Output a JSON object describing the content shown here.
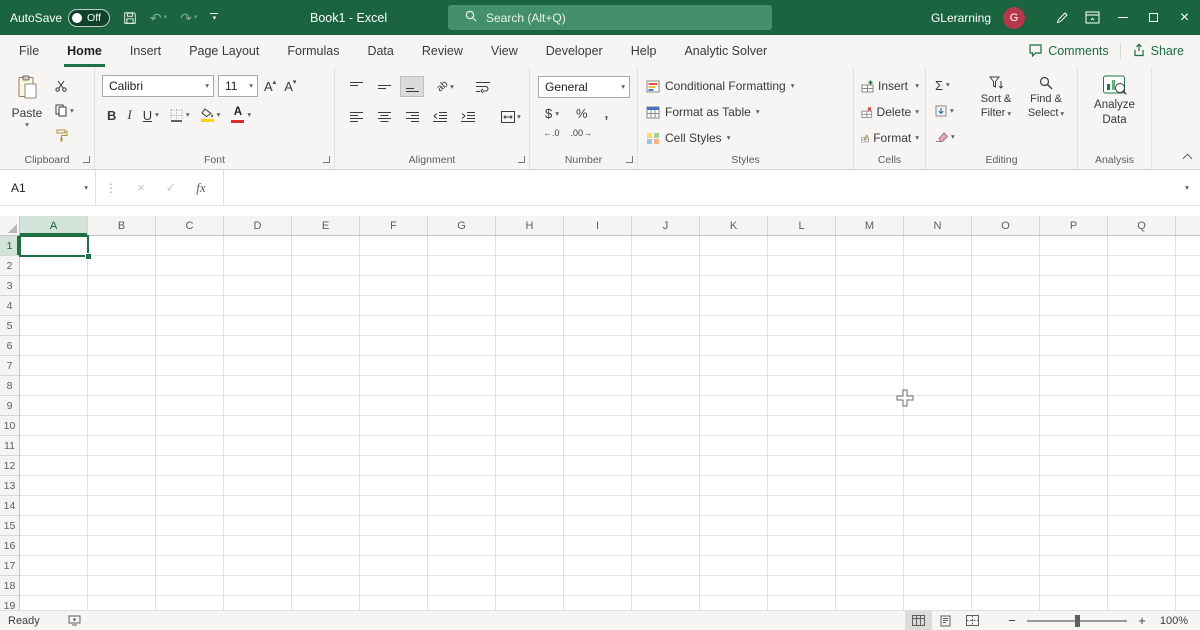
{
  "colors": {
    "titlebar_green": "#1a6440",
    "search_box_green": "#44906a",
    "accent_green": "#1f7145",
    "avatar_red": "#b5394a",
    "fill_color_swatch": "#ffd400",
    "font_color_swatch": "#d92b2b",
    "selected_header_bg": "#d3e3da"
  },
  "titlebar": {
    "autosave_label": "AutoSave",
    "autosave_state": "Off",
    "workbook_title": "Book1  -  Excel",
    "search_placeholder": "Search (Alt+Q)",
    "user_name": "GLerarning",
    "avatar_initial": "G"
  },
  "tabs": {
    "items": [
      {
        "label": "File",
        "active": false
      },
      {
        "label": "Home",
        "active": true
      },
      {
        "label": "Insert",
        "active": false
      },
      {
        "label": "Page Layout",
        "active": false
      },
      {
        "label": "Formulas",
        "active": false
      },
      {
        "label": "Data",
        "active": false
      },
      {
        "label": "Review",
        "active": false
      },
      {
        "label": "View",
        "active": false
      },
      {
        "label": "Developer",
        "active": false
      },
      {
        "label": "Help",
        "active": false
      },
      {
        "label": "Analytic Solver",
        "active": false
      }
    ],
    "comments_label": "Comments",
    "share_label": "Share"
  },
  "ribbon": {
    "clipboard": {
      "group_label": "Clipboard",
      "paste_label": "Paste"
    },
    "font": {
      "group_label": "Font",
      "font_name": "Calibri",
      "font_size": "11",
      "grow_font_letter": "A",
      "shrink_font_letter": "A",
      "bold_label": "B",
      "italic_label": "I",
      "underline_label": "U",
      "font_color_letter": "A"
    },
    "alignment": {
      "group_label": "Alignment",
      "orientation_text": "ab"
    },
    "number": {
      "group_label": "Number",
      "format_value": "General",
      "currency_label": "$",
      "percent_label": "%",
      "comma_label": ",",
      "increase_decimal_label": "←.0",
      "decrease_decimal_label": ".00→"
    },
    "styles": {
      "group_label": "Styles",
      "conditional_label": "Conditional Formatting",
      "table_label": "Format as Table",
      "cell_styles_label": "Cell Styles"
    },
    "cells": {
      "group_label": "Cells",
      "insert_label": "Insert",
      "delete_label": "Delete",
      "format_label": "Format"
    },
    "editing": {
      "group_label": "Editing",
      "autosum_symbol": "Σ",
      "sort_line1": "Sort &",
      "sort_line2": "Filter",
      "find_line1": "Find &",
      "find_line2": "Select"
    },
    "analysis": {
      "group_label": "Analysis",
      "analyze_line1": "Analyze",
      "analyze_line2": "Data"
    }
  },
  "formula_bar": {
    "name_box_value": "A1",
    "fx_label": "fx",
    "formula_value": ""
  },
  "grid": {
    "columns": [
      "A",
      "B",
      "C",
      "D",
      "E",
      "F",
      "G",
      "H",
      "I",
      "J",
      "K",
      "L",
      "M",
      "N",
      "O",
      "P",
      "Q"
    ],
    "rows": [
      "1",
      "2",
      "3",
      "4",
      "5",
      "6",
      "7",
      "8",
      "9",
      "10",
      "11",
      "12",
      "13",
      "14",
      "15",
      "16",
      "17",
      "18",
      "19"
    ],
    "selected": {
      "column": "A",
      "row": "1",
      "cell": "A1"
    }
  },
  "status_bar": {
    "mode_label": "Ready",
    "zoom_value": "100%"
  }
}
